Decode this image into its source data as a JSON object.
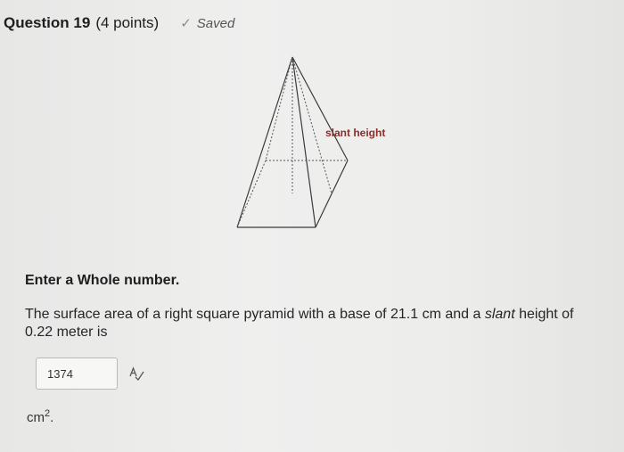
{
  "header": {
    "question_label": "Question 19",
    "points": "(4 points)",
    "saved_label": "Saved",
    "saved_icon": "check-icon"
  },
  "figure": {
    "slant_label": "slant height"
  },
  "instruction": "Enter a Whole number.",
  "question": {
    "part1": "The surface area of a right square pyramid with a base of 21.1 cm and a ",
    "slant_word": "slant",
    "part2": " height of 0.22 meter is"
  },
  "answer": {
    "value": "1374",
    "spell_icon": "spell-check-icon"
  },
  "unit": {
    "base": "cm",
    "exponent": "2",
    "suffix": "."
  }
}
